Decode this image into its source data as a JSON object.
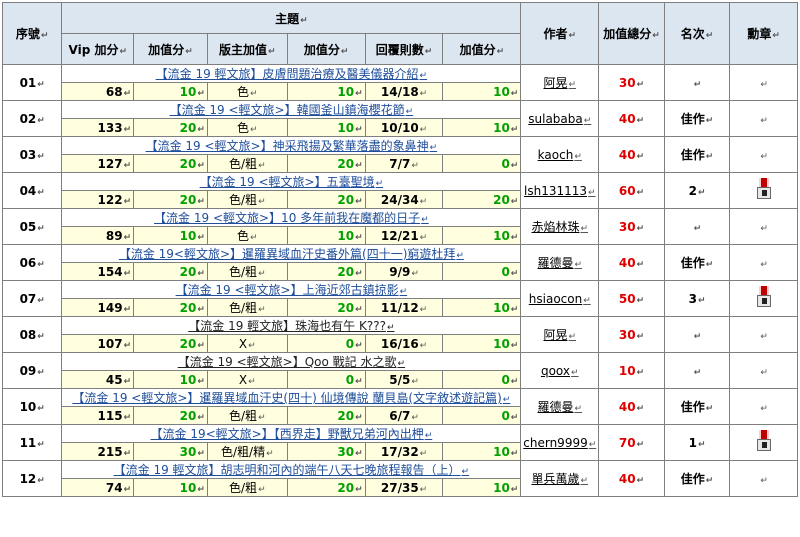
{
  "headers": {
    "seq": "序號",
    "topic": "主題",
    "vip": "Vip 加分",
    "plus1": "加值分",
    "mod": "版主加值",
    "plus2": "加值分",
    "replies": "回覆則數",
    "plus3": "加值分",
    "author": "作者",
    "total": "加值總分",
    "rank": "名次",
    "medal": "勳章"
  },
  "rows": [
    {
      "seq": "01",
      "title": "【流金 19 輕文旅】皮膚問題治療及醫美儀器介紹",
      "vip": "68",
      "v1": "10",
      "mod": "色",
      "v2": "10",
      "replies": "14/18",
      "v3": "10",
      "author": "阿晃",
      "total": "30",
      "rank": "",
      "medal": false,
      "style": "blue"
    },
    {
      "seq": "02",
      "title": "【流金 19 <輕文旅>】韓國釜山鎮海櫻花節",
      "vip": "133",
      "v1": "20",
      "mod": "色",
      "v2": "10",
      "replies": "10/10",
      "v3": "10",
      "author": "sulababa",
      "total": "40",
      "rank": "佳作",
      "medal": false,
      "style": "blue"
    },
    {
      "seq": "03",
      "title": "【流金 19 <輕文旅>】神采飛揚及繁華落盡的象鼻神",
      "vip": "127",
      "v1": "20",
      "mod": "色/粗",
      "v2": "20",
      "replies": "7/7",
      "v3": "0",
      "author": "kaoch",
      "total": "40",
      "rank": "佳作",
      "medal": false,
      "style": "blue"
    },
    {
      "seq": "04",
      "title": "【流金 19 <輕文旅>】五臺聖境",
      "vip": "122",
      "v1": "20",
      "mod": "色/粗",
      "v2": "20",
      "replies": "24/34",
      "v3": "20",
      "author": "lsh131113",
      "total": "60",
      "rank": "2",
      "medal": true,
      "style": "blue"
    },
    {
      "seq": "05",
      "title": "【流金 19 <輕文旅>】10 多年前我在魔都的日子",
      "vip": "89",
      "v1": "10",
      "mod": "色",
      "v2": "10",
      "replies": "12/21",
      "v3": "10",
      "author": "赤焰林珠",
      "total": "30",
      "rank": "",
      "medal": false,
      "style": "blue"
    },
    {
      "seq": "06",
      "title": "【流金 19<輕文旅>】暹羅異域血汗史番外篇(四十一)窮遊杜拜",
      "vip": "154",
      "v1": "20",
      "mod": "色/粗",
      "v2": "20",
      "replies": "9/9",
      "v3": "0",
      "author": "羅德曼",
      "total": "40",
      "rank": "佳作",
      "medal": false,
      "style": "blue"
    },
    {
      "seq": "07",
      "title": "【流金 19 <輕文旅>】上海近郊古鎮掠影",
      "vip": "149",
      "v1": "20",
      "mod": "色/粗",
      "v2": "20",
      "replies": "11/12",
      "v3": "10",
      "author": "hsiaocon",
      "total": "50",
      "rank": "3",
      "medal": true,
      "style": "blue"
    },
    {
      "seq": "08",
      "title": "【流金 19 輕文旅】珠海也有午 K???",
      "vip": "107",
      "v1": "20",
      "mod": "X",
      "v2": "0",
      "replies": "16/16",
      "v3": "10",
      "author": "阿晃",
      "total": "30",
      "rank": "",
      "medal": false,
      "style": "dark"
    },
    {
      "seq": "09",
      "title": "【流金 19 <輕文旅>】Qoo 戰記 水之歌",
      "vip": "45",
      "v1": "10",
      "mod": "X",
      "v2": "0",
      "replies": "5/5",
      "v3": "0",
      "author": "qoox",
      "total": "10",
      "rank": "",
      "medal": false,
      "style": "dark"
    },
    {
      "seq": "10",
      "title": "【流金 19 <輕文旅>】暹羅異域血汗史(四十) 仙境傳說 蘭貝島(文字敘述遊記篇)",
      "vip": "115",
      "v1": "20",
      "mod": "色/粗",
      "v2": "20",
      "replies": "6/7",
      "v3": "0",
      "author": "羅德曼",
      "total": "40",
      "rank": "佳作",
      "medal": false,
      "style": "blue"
    },
    {
      "seq": "11",
      "title": "【流金 19<輕文旅>】【西界走】野獸兄弟河內出柙",
      "vip": "215",
      "v1": "30",
      "mod": "色/粗/精",
      "v2": "30",
      "replies": "17/32",
      "v3": "10",
      "author": "chern9999",
      "total": "70",
      "rank": "1",
      "medal": true,
      "style": "blue"
    },
    {
      "seq": "12",
      "title": "【流金 19 輕文旅】胡志明和河內的端午八天七晚旅程報告（上）",
      "vip": "74",
      "v1": "10",
      "mod": "色/粗",
      "v2": "20",
      "replies": "27/35",
      "v3": "10",
      "author": "單兵萬歲",
      "total": "40",
      "rank": "佳作",
      "medal": false,
      "style": "blue"
    }
  ],
  "colors": {
    "value_bg": "#ffffe0",
    "green": "#00a000",
    "red": "#e00000",
    "header_bg": "#dce6f1",
    "title_blue": "#1f4e9a"
  }
}
